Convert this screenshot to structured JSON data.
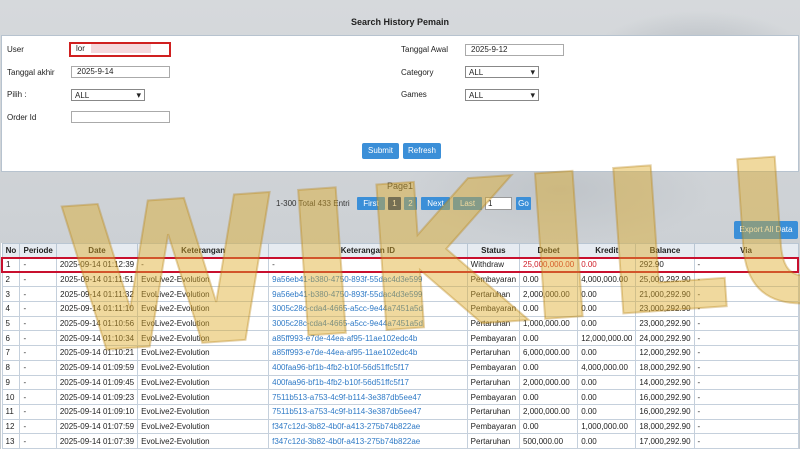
{
  "page": {
    "title": "Search History Pemain"
  },
  "form": {
    "user_label": "User",
    "user_value": "lor",
    "tanggal_awal_label": "Tanggal Awal",
    "tanggal_awal_value": "2025-9-12",
    "tanggal_akhir_label": "Tanggal akhir",
    "tanggal_akhir_value": "2025-9-14",
    "category_label": "Category",
    "category_value": "ALL",
    "pilih_label": "Pilih :",
    "pilih_value": "ALL",
    "games_label": "Games",
    "games_value": "ALL",
    "order_label": "Order Id",
    "order_value": "",
    "submit_label": "Submit",
    "refresh_label": "Refresh"
  },
  "pager": {
    "page_label": "Page1",
    "total_text": "1-300 Total 433 Entri",
    "first": "First",
    "p1": "1",
    "p2": "2",
    "next": "Next",
    "last": "Last",
    "goto_value": "1",
    "go": "Go",
    "export": "Export All Data"
  },
  "watermark": "WIKILUK",
  "table": {
    "headers": [
      "No",
      "Periode",
      "Date",
      "Keterangan",
      "Keterangan ID",
      "Status",
      "Debet",
      "Kredit",
      "Balance",
      "Via"
    ],
    "rows": [
      [
        "1",
        "-",
        "2025-09-14 01:12:39",
        "-",
        "-",
        "Withdraw",
        "25,000,000.00",
        "0.00",
        "292.90",
        "-"
      ],
      [
        "2",
        "-",
        "2025-09-14 01:11:51",
        "EvoLive2-Evolution",
        "9a56eb41-b380-4750-893f-55dac4d3e599",
        "Pembayaran",
        "0.00",
        "4,000,000.00",
        "25,000,292.90",
        "-"
      ],
      [
        "3",
        "-",
        "2025-09-14 01:11:32",
        "EvoLive2-Evolution",
        "9a56eb41-b380-4750-893f-55dac4d3e599",
        "Pertaruhan",
        "2,000,000.00",
        "0.00",
        "21,000,292.90",
        "-"
      ],
      [
        "4",
        "-",
        "2025-09-14 01:11:10",
        "EvoLive2-Evolution",
        "3005c28c-cda4-4665-a5cc-9e44a7451a5d",
        "Pembayaran",
        "0.00",
        "0.00",
        "23,000,292.90",
        "-"
      ],
      [
        "5",
        "-",
        "2025-09-14 01:10:56",
        "EvoLive2-Evolution",
        "3005c28c-cda4-4665-a5cc-9e44a7451a5d",
        "Pertaruhan",
        "1,000,000.00",
        "0.00",
        "23,000,292.90",
        "-"
      ],
      [
        "6",
        "-",
        "2025-09-14 01:10:34",
        "EvoLive2-Evolution",
        "a85ff993-e7de-44ea-af95-11ae102edc4b",
        "Pembayaran",
        "0.00",
        "12,000,000.00",
        "24,000,292.90",
        "-"
      ],
      [
        "7",
        "-",
        "2025-09-14 01:10:21",
        "EvoLive2-Evolution",
        "a85ff993-e7de-44ea-af95-11ae102edc4b",
        "Pertaruhan",
        "6,000,000.00",
        "0.00",
        "12,000,292.90",
        "-"
      ],
      [
        "8",
        "-",
        "2025-09-14 01:09:59",
        "EvoLive2-Evolution",
        "400faa96-bf1b-4fb2-b10f-56d51ffc5f17",
        "Pembayaran",
        "0.00",
        "4,000,000.00",
        "18,000,292.90",
        "-"
      ],
      [
        "9",
        "-",
        "2025-09-14 01:09:45",
        "EvoLive2-Evolution",
        "400faa96-bf1b-4fb2-b10f-56d51ffc5f17",
        "Pertaruhan",
        "2,000,000.00",
        "0.00",
        "14,000,292.90",
        "-"
      ],
      [
        "10",
        "-",
        "2025-09-14 01:09:23",
        "EvoLive2-Evolution",
        "7511b513-a753-4c9f-b114-3e387db5ee47",
        "Pembayaran",
        "0.00",
        "0.00",
        "16,000,292.90",
        "-"
      ],
      [
        "11",
        "-",
        "2025-09-14 01:09:10",
        "EvoLive2-Evolution",
        "7511b513-a753-4c9f-b114-3e387db5ee47",
        "Pertaruhan",
        "2,000,000.00",
        "0.00",
        "16,000,292.90",
        "-"
      ],
      [
        "12",
        "-",
        "2025-09-14 01:07:59",
        "EvoLive2-Evolution",
        "f347c12d-3b82-4b0f-a413-275b74b822ae",
        "Pembayaran",
        "0.00",
        "1,000,000.00",
        "18,000,292.90",
        "-"
      ],
      [
        "13",
        "-",
        "2025-09-14 01:07:39",
        "EvoLive2-Evolution",
        "f347c12d-3b82-4b0f-a413-275b74b822ae",
        "Pertaruhan",
        "500,000.00",
        "0.00",
        "17,000,292.90",
        "-"
      ]
    ]
  }
}
